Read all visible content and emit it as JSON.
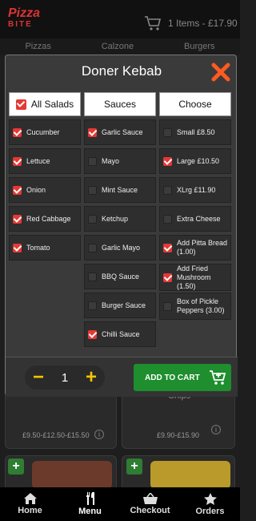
{
  "header": {
    "logo_top": "Pizza",
    "logo_bottom": "BITE",
    "cart_text": "1 Items - £17.90"
  },
  "categories": [
    "Pizzas",
    "Calzone",
    "Burgers"
  ],
  "background_cards": [
    {
      "title": "",
      "price": "£9.50-£12.50-£15.50"
    },
    {
      "title": "Chips",
      "price": "£9.90-£15.90"
    }
  ],
  "modal": {
    "title": "Doner Kebab",
    "columns": [
      {
        "label": "All Salads",
        "checked": true
      },
      {
        "label": "Sauces"
      },
      {
        "label": "Choose"
      }
    ],
    "salads": [
      {
        "label": "Cucumber",
        "checked": true
      },
      {
        "label": "Lettuce",
        "checked": true
      },
      {
        "label": "Onion",
        "checked": true
      },
      {
        "label": "Red Cabbage",
        "checked": true
      },
      {
        "label": "Tomato",
        "checked": true
      }
    ],
    "sauces": [
      {
        "label": "Garlic Sauce",
        "checked": true
      },
      {
        "label": "Mayo",
        "checked": false
      },
      {
        "label": "Mint Sauce",
        "checked": false
      },
      {
        "label": "Ketchup",
        "checked": false
      },
      {
        "label": "Garlic Mayo",
        "checked": false
      },
      {
        "label": "BBQ Sauce",
        "checked": false
      },
      {
        "label": "Burger Sauce",
        "checked": false
      },
      {
        "label": "Chilli Sauce",
        "checked": true
      }
    ],
    "choose": [
      {
        "label": "Small £8.50",
        "checked": false
      },
      {
        "label": "Large £10.50",
        "checked": true
      },
      {
        "label": "XLrg £11.90",
        "checked": false
      },
      {
        "label": "Extra Cheese",
        "checked": false
      },
      {
        "label": "Add Pitta Bread (1.00)",
        "checked": true
      },
      {
        "label": "Add Fried Mushroom (1.50)",
        "checked": true
      },
      {
        "label": "Box of Pickle Peppers (3.00)",
        "checked": false
      }
    ],
    "quantity": "1",
    "minus": "−",
    "plus": "+",
    "add_to_cart": "ADD TO CART"
  },
  "nav": [
    {
      "label": "Home",
      "icon": "home-icon"
    },
    {
      "label": "Menu",
      "icon": "cutlery-icon"
    },
    {
      "label": "Checkout",
      "icon": "basket-icon"
    },
    {
      "label": "Orders",
      "icon": "star-icon"
    }
  ],
  "colors": {
    "accent_red": "#e53935",
    "add_green": "#1e8e2e",
    "qty_yellow": "#f5c400"
  }
}
